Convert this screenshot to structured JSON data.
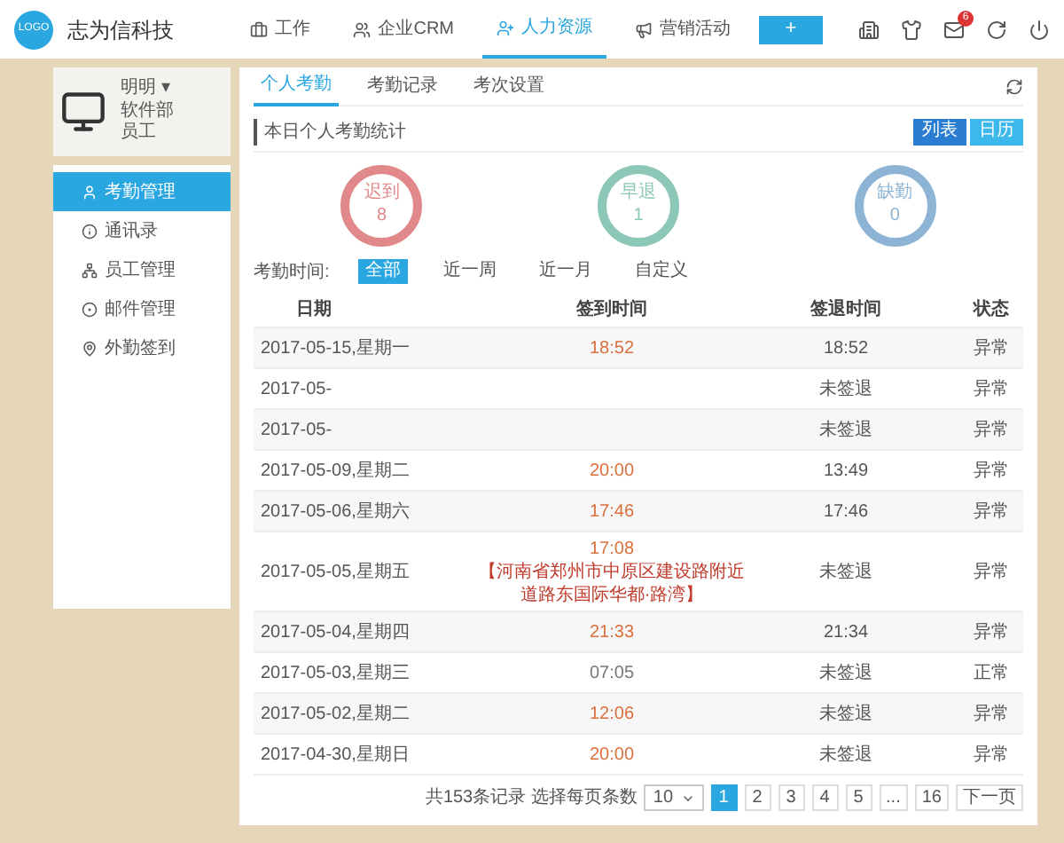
{
  "header": {
    "logo": "LOGO",
    "company": "志为信科技",
    "nav": [
      {
        "label": "工作",
        "selected": false
      },
      {
        "label": "企业CRM",
        "selected": false
      },
      {
        "label": "人力资源",
        "selected": true
      },
      {
        "label": "营销活动",
        "selected": false
      }
    ],
    "add_button": "+",
    "mail_badge": "6"
  },
  "profile": {
    "name": "明明 ▾",
    "department": "软件部",
    "role": "员工"
  },
  "sidebar": {
    "items": [
      {
        "label": "考勤管理",
        "selected": true
      },
      {
        "label": "通讯录",
        "selected": false
      },
      {
        "label": "员工管理",
        "selected": false
      },
      {
        "label": "邮件管理",
        "selected": false
      },
      {
        "label": "外勤签到",
        "selected": false
      }
    ]
  },
  "tabs": [
    {
      "label": "个人考勤",
      "selected": true
    },
    {
      "label": "考勤记录",
      "selected": false
    },
    {
      "label": "考次设置",
      "selected": false
    }
  ],
  "stats_card": {
    "title": "本日个人考勤统计",
    "view_buttons": [
      {
        "label": "列表",
        "selected": true
      },
      {
        "label": "日历",
        "selected": false
      }
    ],
    "stats": [
      {
        "label": "迟到",
        "value": "8",
        "color": "#e0888a"
      },
      {
        "label": "早退",
        "value": "1",
        "color": "#8cc7b8"
      },
      {
        "label": "缺勤",
        "value": "0",
        "color": "#8db4d4"
      }
    ]
  },
  "filter": {
    "label": "考勤时间:",
    "options": [
      {
        "label": "全部",
        "selected": true
      },
      {
        "label": "近一周",
        "selected": false
      },
      {
        "label": "近一月",
        "selected": false
      },
      {
        "label": "自定义",
        "selected": false
      }
    ]
  },
  "table": {
    "columns": [
      "日期",
      "签到时间",
      "签退时间",
      "状态"
    ],
    "rows": [
      {
        "date": "2017-05-15,星期一",
        "sign_in": "18:52",
        "late": true,
        "sign_out": "18:52",
        "status": "异常"
      },
      {
        "date": "2017-05-",
        "sign_out": "未签退",
        "status": "异常"
      },
      {
        "date": "2017-05-",
        "sign_out": "未签退",
        "status": "异常"
      },
      {
        "date": "2017-05-09,星期二",
        "sign_in": "20:00",
        "late": true,
        "sign_out": "13:49",
        "status": "异常"
      },
      {
        "date": "2017-05-06,星期六",
        "sign_in": "17:46",
        "late": true,
        "sign_out": "17:46",
        "status": "异常"
      },
      {
        "date": "2017-05-05,星期五",
        "sign_in": "17:08",
        "location": "【河南省郑州市中原区建设路附近道路东国际华都·路湾】",
        "late": true,
        "sign_out": "未签退",
        "status": "异常"
      },
      {
        "date": "2017-05-04,星期四",
        "sign_in": "21:33",
        "late": true,
        "sign_out": "21:34",
        "status": "异常"
      },
      {
        "date": "2017-05-03,星期三",
        "sign_in": "07:05",
        "late": false,
        "sign_out": "未签退",
        "status": "正常"
      },
      {
        "date": "2017-05-02,星期二",
        "sign_in": "12:06",
        "late": true,
        "sign_out": "未签退",
        "status": "异常"
      },
      {
        "date": "2017-04-30,星期日",
        "sign_in": "20:00",
        "late": true,
        "sign_out": "未签退",
        "status": "异常"
      }
    ]
  },
  "pagination": {
    "summary": "共153条记录 选择每页条数",
    "page_size": "10",
    "pages": [
      {
        "label": "1",
        "selected": true
      },
      {
        "label": "2",
        "selected": false
      },
      {
        "label": "3",
        "selected": false
      },
      {
        "label": "4",
        "selected": false
      },
      {
        "label": "5",
        "selected": false
      },
      {
        "label": "...",
        "selected": false
      },
      {
        "label": "16",
        "selected": false
      }
    ],
    "next": "下一页"
  }
}
